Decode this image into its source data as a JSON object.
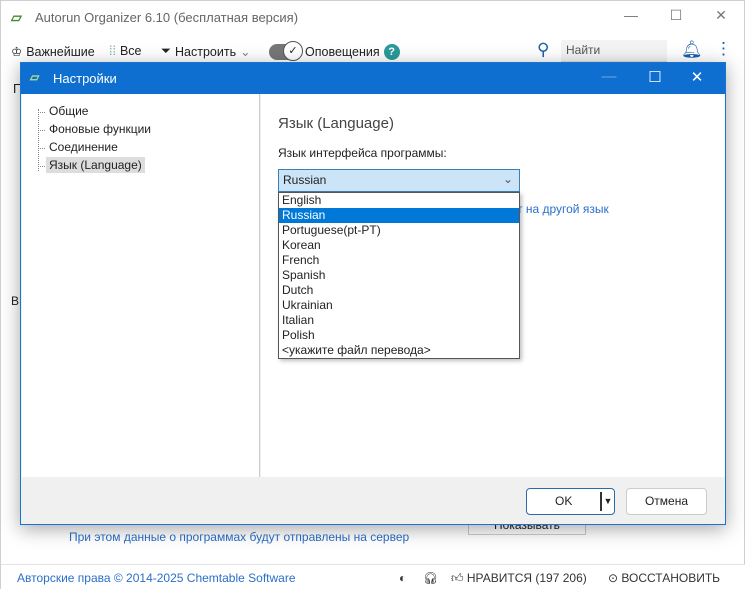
{
  "window": {
    "title": "Autorun Organizer 6.10 (бесплатная версия)"
  },
  "toolbar": {
    "important": "Важнейшие",
    "all": "Все",
    "configure": "Настроить",
    "notifications": "Оповещения",
    "search_placeholder": "Найти"
  },
  "background": {
    "info_text": "При этом данные о программах будут отправлены на сервер",
    "show_button": "Показывать",
    "left_tab_fragment": "ВР",
    "left_letter": "П"
  },
  "dialog": {
    "title": "Настройки",
    "tree": [
      "Общие",
      "Фоновые функции",
      "Соединение",
      "Язык (Language)"
    ],
    "section_title": "Язык (Language)",
    "label": "Язык интерфейса программы:",
    "selected": "Russian",
    "options": [
      "English",
      "Russian",
      "Portuguese(pt-PT)",
      "Korean",
      "French",
      "Spanish",
      "Dutch",
      "Ukrainian",
      "Italian",
      "Polish",
      "<укажите файл перевода>"
    ],
    "link_fragment": "т на другой язык",
    "ok": "OK",
    "cancel": "Отмена"
  },
  "status": {
    "copyright": "Авторские права © 2014-2025 Chemtable Software",
    "likes": "НРАВИТСЯ (197 206)",
    "restore": "ВОССТАНОВИТЬ"
  },
  "colors": {
    "accent": "#0e6fd0",
    "selection": "#0078d7",
    "link": "#2a6fc9"
  }
}
